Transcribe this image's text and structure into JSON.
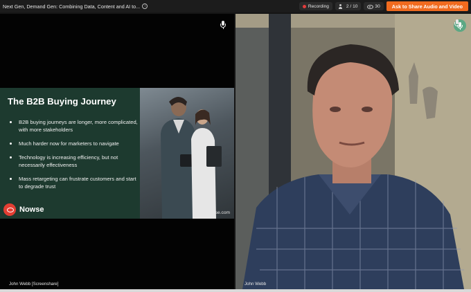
{
  "topbar": {
    "title": "Next Gen, Demand Gen: Combining Data, Content and AI to...",
    "recording_label": "Recording",
    "participants": "2 / 10",
    "viewers": "30",
    "share_button": "Ask to Share Audio and Video"
  },
  "slide": {
    "title": "The B2B Buying Journey",
    "bullets": [
      "B2B buying journeys are longer, more complicated, with more stakeholders",
      "Much harder now for marketers to navigate",
      "Technology is increasing efficiency, but not necessarily effectiveness",
      "Mass retargeting can frustrate customers and start to degrade trust"
    ],
    "logo_text": "Nowse",
    "site": "nowse.com"
  },
  "tiles": {
    "left_name": "John Webb [Screenshare]",
    "right_name": "John Webb"
  },
  "icons": {
    "left_mic": "microphone-icon",
    "right_mic": "microphone-icon",
    "info": "info-icon",
    "recording": "record-dot-icon",
    "participants": "people-icon",
    "viewers": "eye-icon"
  },
  "colors": {
    "accent": "#f06b1f",
    "recording_dot": "#e23c3c",
    "slide_bg": "#1d3a2f",
    "mic_active": "#5ca884"
  }
}
